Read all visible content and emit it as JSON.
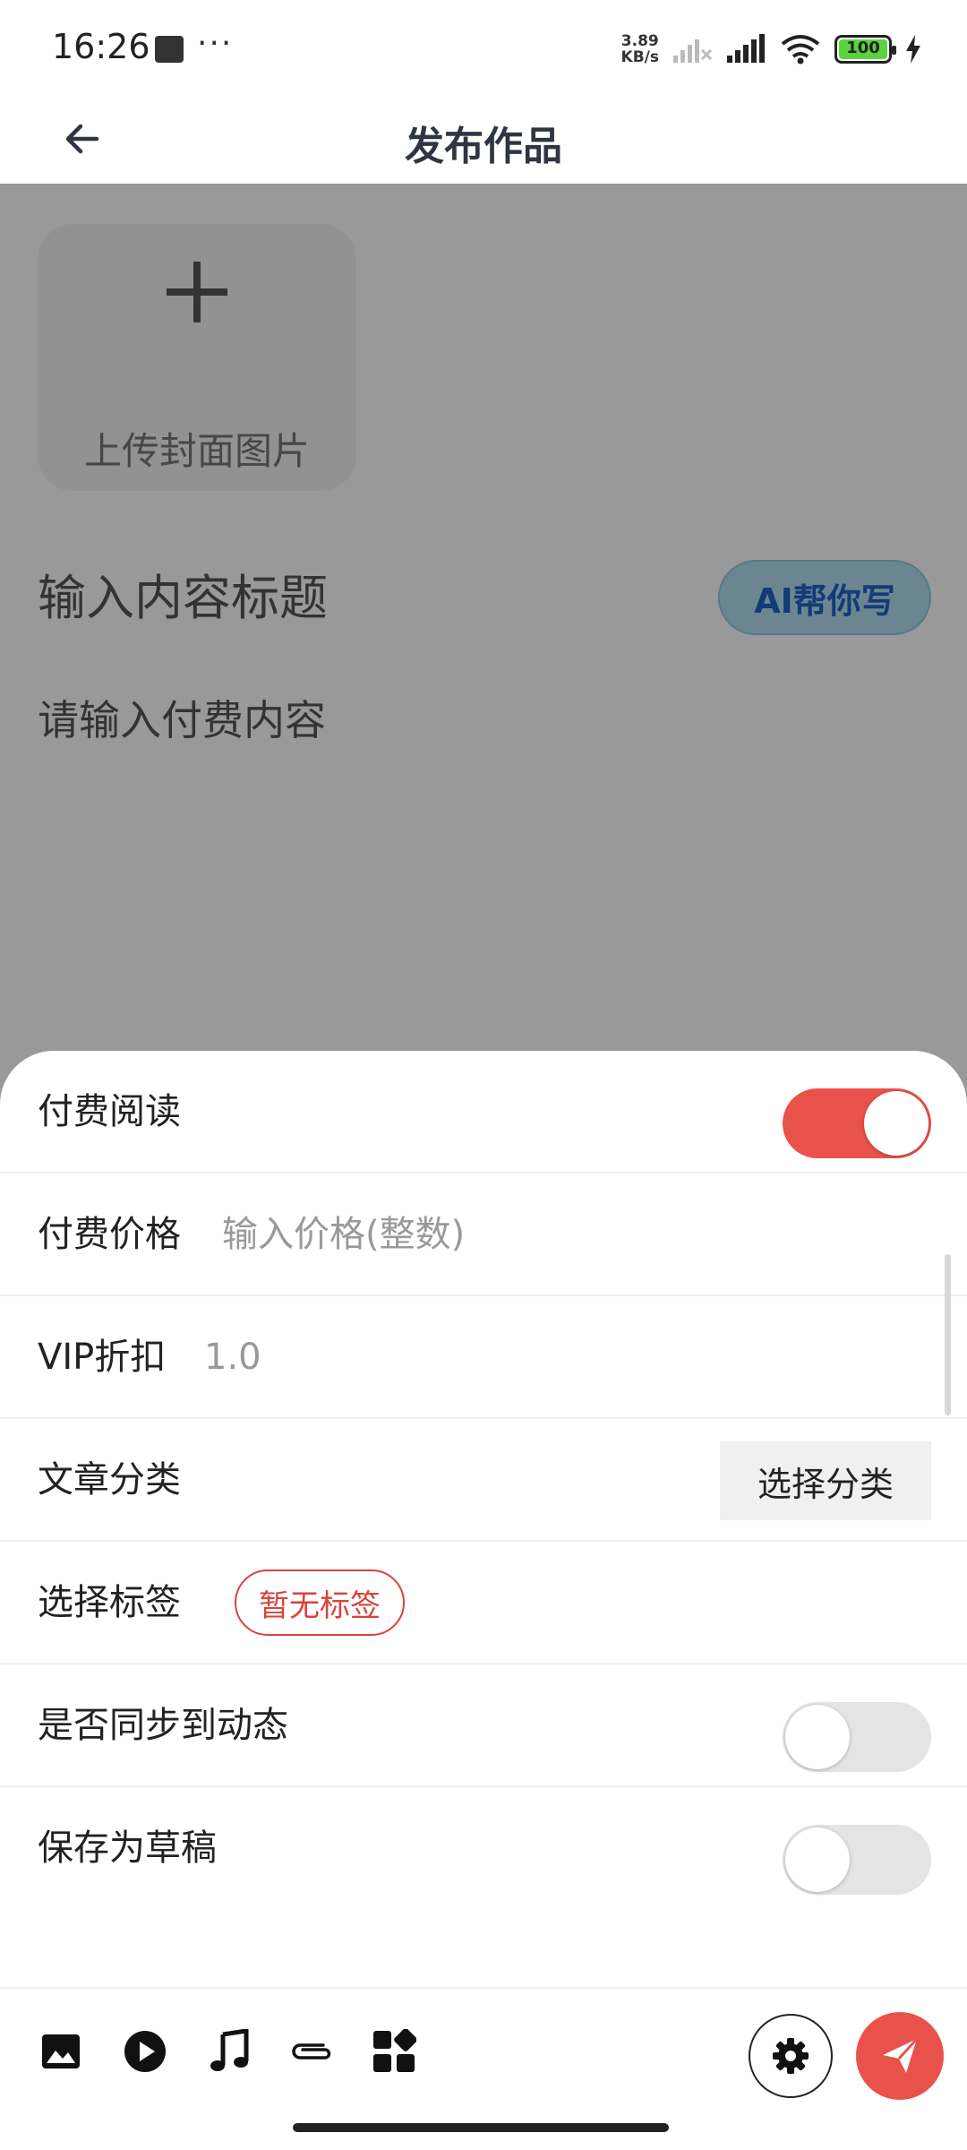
{
  "status_bar": {
    "time": "16:26",
    "dots": "···",
    "speed_value": "3.89",
    "speed_unit": "KB/s",
    "battery": "100",
    "icons": [
      "notification-square-icon",
      "signal-x-icon",
      "signal-icon",
      "wifi-icon",
      "battery-icon",
      "charging-bolt-icon"
    ]
  },
  "header": {
    "title": "发布作品",
    "back_icon": "arrow-left-icon"
  },
  "content": {
    "cover_label": "上传封面图片",
    "title_placeholder": "输入内容标题",
    "ai_button_label": "AI帮你写",
    "paid_content_placeholder": "请输入付费内容"
  },
  "sheet": {
    "paid_read": {
      "label": "付费阅读",
      "on": true
    },
    "price": {
      "label": "付费价格",
      "placeholder": "输入价格(整数)"
    },
    "vip": {
      "label": "VIP折扣",
      "value": "1.0"
    },
    "category": {
      "label": "文章分类",
      "button": "选择分类"
    },
    "tags": {
      "label": "选择标签",
      "chip": "暂无标签"
    },
    "sync": {
      "label": "是否同步到动态",
      "on": false
    },
    "draft": {
      "label": "保存为草稿",
      "on": false
    }
  },
  "toolbar": {
    "icons": [
      "image-icon",
      "play-circle-icon",
      "music-note-icon",
      "paperclip-icon",
      "apps-grid-icon",
      "settings-gear-icon",
      "send-icon"
    ]
  },
  "colors": {
    "accent": "#e8524a",
    "ai_button_bg": "#b3dff0",
    "ai_button_text": "#1e63c7",
    "title": "#2f3542"
  }
}
